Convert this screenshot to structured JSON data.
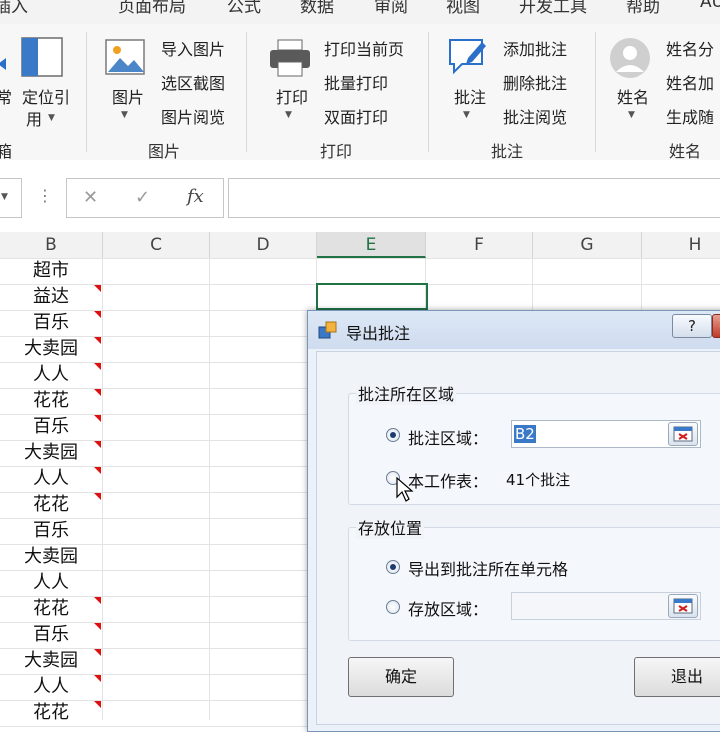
{
  "ribbon_tabs": [
    "插入",
    "页面布局",
    "公式",
    "数据",
    "审阅",
    "视图",
    "开发工具",
    "帮助",
    "AU"
  ],
  "ribbon": {
    "left_partial": {
      "label_line1": "常",
      "label_line2": "箱"
    },
    "locate_button": {
      "label_line1": "定位引",
      "label_line2": "用"
    },
    "picture_group": {
      "big_label": "图片",
      "items": [
        "导入图片",
        "选区截图",
        "图片阅览"
      ],
      "group_label": "图片"
    },
    "print_group": {
      "big_label": "打印",
      "items": [
        "打印当前页",
        "批量打印",
        "双面打印"
      ],
      "group_label": "打印"
    },
    "comment_group": {
      "big_label": "批注",
      "items": [
        "添加批注",
        "删除批注",
        "批注阅览"
      ],
      "group_label": "批注"
    },
    "name_group": {
      "big_label": "姓名",
      "items": [
        "姓名分",
        "姓名加",
        "生成随"
      ],
      "group_label": "姓名"
    }
  },
  "formula_bar": {
    "cancel": "✕",
    "enter": "✓",
    "fx": "fx",
    "more": "⋮",
    "value": ""
  },
  "sheet": {
    "columns": [
      "B",
      "C",
      "D",
      "E",
      "F",
      "G",
      "H"
    ],
    "column_b_values": [
      "超市",
      "益达",
      "百乐",
      "大卖园",
      "人人",
      "花花",
      "百乐",
      "大卖园",
      "人人",
      "花花",
      "百乐",
      "大卖园",
      "人人",
      "花花",
      "百乐",
      "大卖园",
      "人人",
      "花花"
    ],
    "comment_marker_rows": [
      1,
      2,
      3,
      4,
      5,
      6,
      7,
      8,
      9,
      13,
      14,
      15,
      16,
      17
    ],
    "accent": "#217346",
    "comment_color": "#e01010"
  },
  "dialog": {
    "title": "导出批注",
    "help": "?",
    "section1": "批注所在区域",
    "radio_range": {
      "label": "批注区域：",
      "value": "B2",
      "selected": true
    },
    "radio_sheet": {
      "label": "本工作表：",
      "count": "41个批注",
      "selected": false
    },
    "section2": "存放位置",
    "radio_export_in_cell": {
      "label": "导出到批注所在单元格",
      "selected": true
    },
    "radio_store_range": {
      "label": "存放区域：",
      "value": "",
      "selected": false
    },
    "ok": "确定",
    "exit": "退出"
  }
}
